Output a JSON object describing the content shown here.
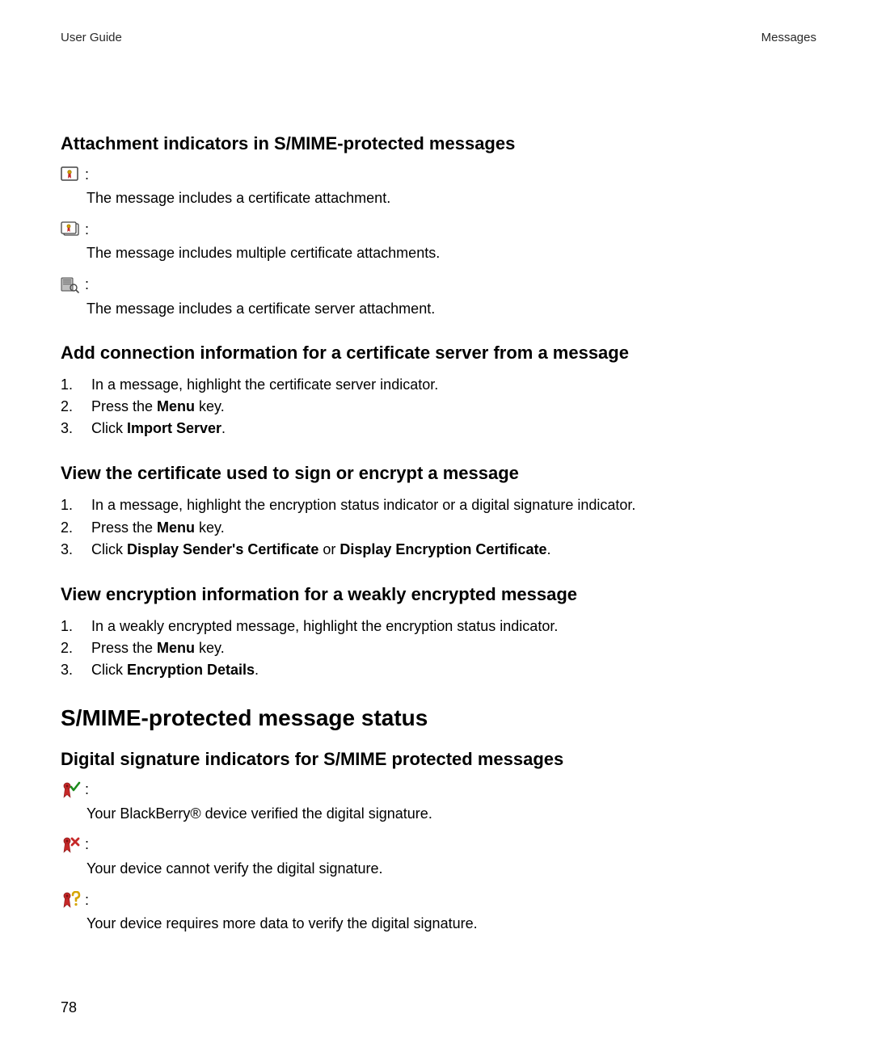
{
  "header": {
    "left": "User Guide",
    "right": "Messages"
  },
  "section1": {
    "title": "Attachment indicators in S/MIME-protected messages",
    "items": [
      {
        "icon": "cert-single-icon",
        "desc": "The message includes a certificate attachment."
      },
      {
        "icon": "cert-multi-icon",
        "desc": "The message includes multiple certificate attachments."
      },
      {
        "icon": "cert-server-icon",
        "desc": "The message includes a certificate server attachment."
      }
    ]
  },
  "section2": {
    "title": "Add connection information for a certificate server from a message",
    "steps": [
      {
        "n": "1.",
        "pre": "In a message, highlight the certificate server indicator.",
        "bold1": "",
        "mid": "",
        "bold2": "",
        "post": ""
      },
      {
        "n": "2.",
        "pre": "Press the ",
        "bold1": "Menu",
        "mid": " key.",
        "bold2": "",
        "post": ""
      },
      {
        "n": "3.",
        "pre": "Click ",
        "bold1": "Import Server",
        "mid": ".",
        "bold2": "",
        "post": ""
      }
    ]
  },
  "section3": {
    "title": "View the certificate used to sign or encrypt a message",
    "steps": [
      {
        "n": "1.",
        "pre": "In a message, highlight the encryption status indicator or a digital signature indicator.",
        "bold1": "",
        "mid": "",
        "bold2": "",
        "post": ""
      },
      {
        "n": "2.",
        "pre": "Press the ",
        "bold1": "Menu",
        "mid": " key.",
        "bold2": "",
        "post": ""
      },
      {
        "n": "3.",
        "pre": "Click ",
        "bold1": "Display Sender's Certificate",
        "mid": " or ",
        "bold2": "Display Encryption Certificate",
        "post": "."
      }
    ]
  },
  "section4": {
    "title": "View encryption information for a weakly encrypted message",
    "steps": [
      {
        "n": "1.",
        "pre": "In a weakly encrypted message, highlight the encryption status indicator.",
        "bold1": "",
        "mid": "",
        "bold2": "",
        "post": ""
      },
      {
        "n": "2.",
        "pre": "Press the ",
        "bold1": "Menu",
        "mid": " key.",
        "bold2": "",
        "post": ""
      },
      {
        "n": "3.",
        "pre": "Click ",
        "bold1": "Encryption Details",
        "mid": ".",
        "bold2": "",
        "post": ""
      }
    ]
  },
  "status_heading": "S/MIME-protected message status",
  "section5": {
    "title": "Digital signature indicators for S/MIME protected messages",
    "items": [
      {
        "icon": "sig-verified-icon",
        "desc": "Your BlackBerry® device verified the digital signature."
      },
      {
        "icon": "sig-failed-icon",
        "desc": "Your device cannot verify the digital signature."
      },
      {
        "icon": "sig-pending-icon",
        "desc": "Your device requires more data to verify the digital signature."
      }
    ]
  },
  "page_number": "78",
  "colon": ":"
}
